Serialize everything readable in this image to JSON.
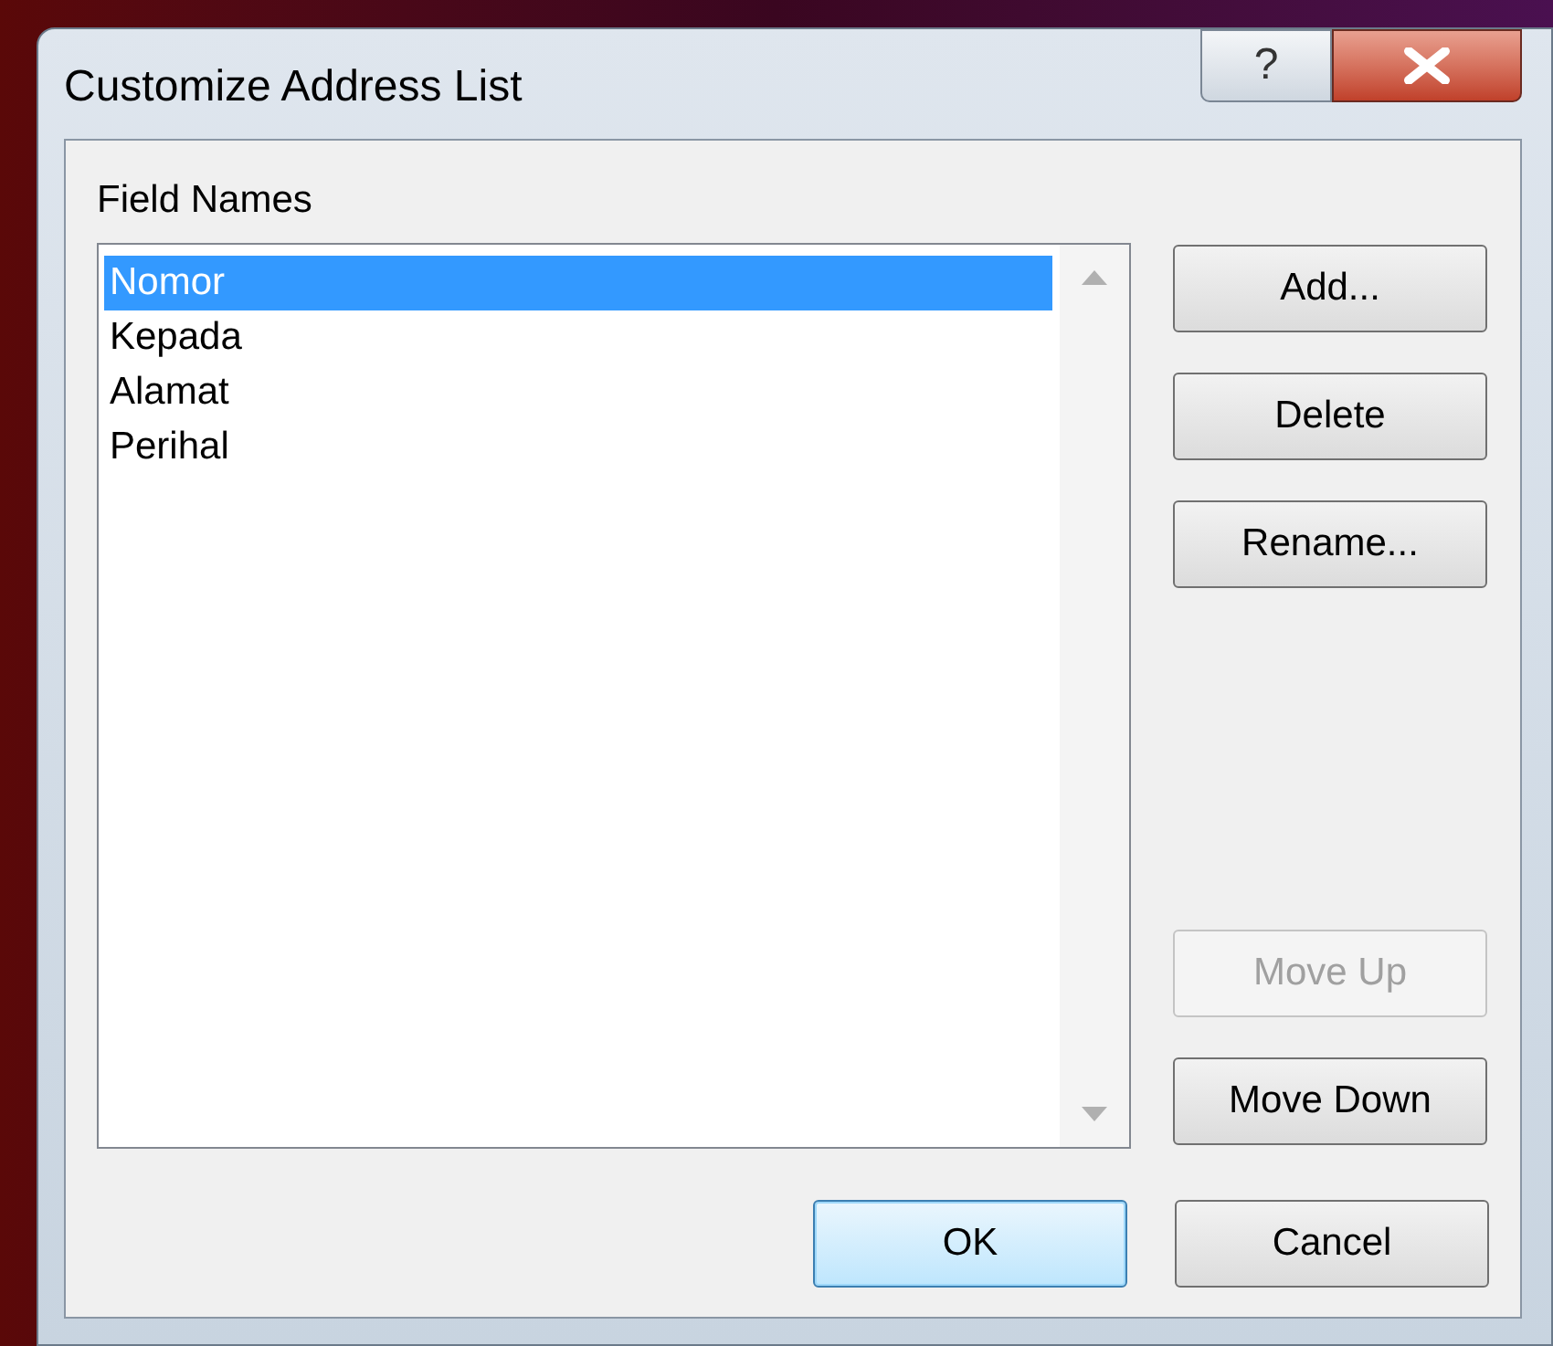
{
  "window": {
    "title": "Customize Address List"
  },
  "title_buttons": [
    {
      "kind": "help",
      "label": "?"
    },
    {
      "kind": "close"
    }
  ],
  "field_list": {
    "label": "Field Names",
    "items": [
      {
        "label": "Nomor",
        "selected": true
      },
      {
        "label": "Kepada",
        "selected": false
      },
      {
        "label": "Alamat",
        "selected": false
      },
      {
        "label": "Perihal",
        "selected": false
      }
    ]
  },
  "side_buttons": [
    {
      "label": "Add...",
      "disabled": false
    },
    {
      "label": "Delete",
      "disabled": false
    },
    {
      "label": "Rename...",
      "disabled": false
    },
    {
      "label": "Move Up",
      "disabled": true
    },
    {
      "label": "Move Down",
      "disabled": false
    }
  ],
  "footer_buttons": [
    {
      "label": "OK",
      "default": true
    },
    {
      "label": "Cancel",
      "default": false
    }
  ]
}
